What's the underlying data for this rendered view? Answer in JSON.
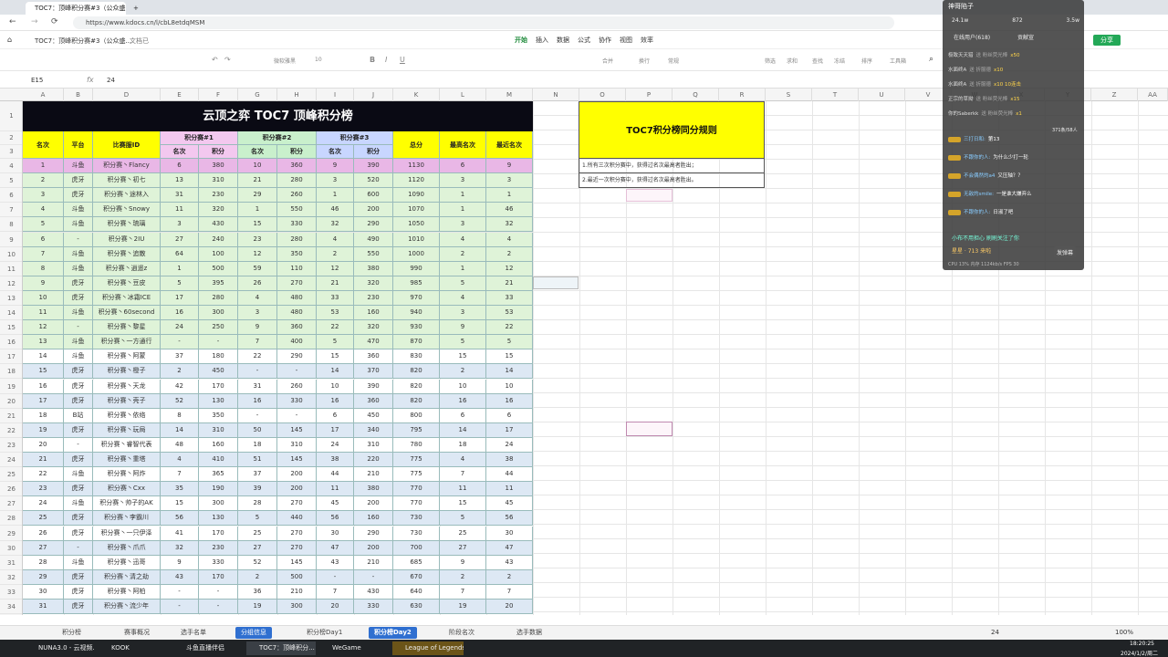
{
  "browser": {
    "tabs": [
      {
        "title": "TOC7：顶峰积分赛#3（公众盛...",
        "active": true
      },
      {
        "title": "+",
        "active": false
      }
    ],
    "url": "https://www.kdocs.cn/l/cbL8etdqMSM"
  },
  "doc": {
    "title": "TOC7：顶峰积分赛#3（公众盛...",
    "saved": "文档已",
    "menu": [
      "开始",
      "插入",
      "数据",
      "公式",
      "协作",
      "视图",
      "效率"
    ],
    "share": "分享",
    "toolbar": [
      "微软雅黑",
      "10",
      "合并",
      "换行",
      "常规",
      "筛选",
      "求和",
      "查找",
      "冻结",
      "排序",
      "工具箱"
    ],
    "cellref": "E15",
    "formula": "24"
  },
  "columns": [
    "A",
    "B",
    "D",
    "E",
    "F",
    "G",
    "H",
    "I",
    "J",
    "K",
    "L",
    "M",
    "N",
    "O",
    "P",
    "Q",
    "R",
    "S",
    "T",
    "U",
    "V",
    "W",
    "X",
    "Y",
    "Z",
    "AA"
  ],
  "table": {
    "title": "云顶之弈 TOC7 顶峰积分榜",
    "headers": {
      "rank": "名次",
      "platform": "平台",
      "id": "比赛服ID",
      "s1": "积分赛#1",
      "s2": "积分赛#2",
      "s3": "积分赛#3",
      "sub_rank": "名次",
      "sub_pts": "积分",
      "total": "总分",
      "best": "最高名次",
      "recent": "最近名次"
    },
    "rows": [
      [
        "1",
        "斗鱼",
        "积分赛丶Flancy",
        "6",
        "380",
        "10",
        "360",
        "9",
        "390",
        "1130",
        "6",
        "9"
      ],
      [
        "2",
        "虎牙",
        "积分赛丶初七",
        "13",
        "310",
        "21",
        "280",
        "3",
        "520",
        "1120",
        "3",
        "3"
      ],
      [
        "3",
        "虎牙",
        "积分赛丶途林入",
        "31",
        "230",
        "29",
        "260",
        "1",
        "600",
        "1090",
        "1",
        "1"
      ],
      [
        "4",
        "斗鱼",
        "积分赛丶Snowy",
        "11",
        "320",
        "1",
        "550",
        "46",
        "200",
        "1070",
        "1",
        "46"
      ],
      [
        "5",
        "斗鱼",
        "积分赛丶琉璃",
        "3",
        "430",
        "15",
        "330",
        "32",
        "290",
        "1050",
        "3",
        "32"
      ],
      [
        "6",
        "-",
        "积分赛丶2IU",
        "27",
        "240",
        "23",
        "280",
        "4",
        "490",
        "1010",
        "4",
        "4"
      ],
      [
        "7",
        "斗鱼",
        "积分赛丶追散",
        "64",
        "100",
        "12",
        "350",
        "2",
        "550",
        "1000",
        "2",
        "2"
      ],
      [
        "8",
        "斗鱼",
        "积分赛丶逍遥z",
        "1",
        "500",
        "59",
        "110",
        "12",
        "380",
        "990",
        "1",
        "12"
      ],
      [
        "9",
        "虎牙",
        "积分赛丶豆皮",
        "5",
        "395",
        "26",
        "270",
        "21",
        "320",
        "985",
        "5",
        "21"
      ],
      [
        "10",
        "虎牙",
        "积分赛丶冰霜ICE",
        "17",
        "280",
        "4",
        "480",
        "33",
        "230",
        "970",
        "4",
        "33"
      ],
      [
        "11",
        "斗鱼",
        "积分赛丶60second",
        "16",
        "300",
        "3",
        "480",
        "53",
        "160",
        "940",
        "3",
        "53"
      ],
      [
        "12",
        "-",
        "积分赛丶黎星",
        "24",
        "250",
        "9",
        "360",
        "22",
        "320",
        "930",
        "9",
        "22"
      ],
      [
        "13",
        "斗鱼",
        "积分赛丶一方通行",
        "-",
        "-",
        "7",
        "400",
        "5",
        "470",
        "870",
        "5",
        "5"
      ],
      [
        "14",
        "斗鱼",
        "积分赛丶阿蒙",
        "37",
        "180",
        "22",
        "290",
        "15",
        "360",
        "830",
        "15",
        "15"
      ],
      [
        "15",
        "虎牙",
        "积分赛丶橙子",
        "2",
        "450",
        "-",
        "-",
        "14",
        "370",
        "820",
        "2",
        "14"
      ],
      [
        "16",
        "虎牙",
        "积分赛丶天龙",
        "42",
        "170",
        "31",
        "260",
        "10",
        "390",
        "820",
        "10",
        "10"
      ],
      [
        "17",
        "虎牙",
        "积分赛丶壳子",
        "52",
        "130",
        "16",
        "330",
        "16",
        "360",
        "820",
        "16",
        "16"
      ],
      [
        "18",
        "B站",
        "积分赛丶依络",
        "8",
        "350",
        "-",
        "-",
        "6",
        "450",
        "800",
        "6",
        "6"
      ],
      [
        "19",
        "虎牙",
        "积分赛丶玩局",
        "14",
        "310",
        "50",
        "145",
        "17",
        "340",
        "795",
        "14",
        "17"
      ],
      [
        "20",
        "-",
        "积分赛丶睿智代表",
        "48",
        "160",
        "18",
        "310",
        "24",
        "310",
        "780",
        "18",
        "24"
      ],
      [
        "21",
        "虎牙",
        "积分赛丶重塔",
        "4",
        "410",
        "51",
        "145",
        "38",
        "220",
        "775",
        "4",
        "38"
      ],
      [
        "22",
        "斗鱼",
        "积分赛丶阿炸",
        "7",
        "365",
        "37",
        "200",
        "44",
        "210",
        "775",
        "7",
        "44"
      ],
      [
        "23",
        "虎牙",
        "积分赛丶Cxx",
        "35",
        "190",
        "39",
        "200",
        "11",
        "380",
        "770",
        "11",
        "11"
      ],
      [
        "24",
        "斗鱼",
        "积分赛丶帅子的AK",
        "15",
        "300",
        "28",
        "270",
        "45",
        "200",
        "770",
        "15",
        "45"
      ],
      [
        "25",
        "虎牙",
        "积分赛丶李霸川",
        "56",
        "130",
        "5",
        "440",
        "56",
        "160",
        "730",
        "5",
        "56"
      ],
      [
        "26",
        "虎牙",
        "积分赛丶一只伊泽",
        "41",
        "170",
        "25",
        "270",
        "30",
        "290",
        "730",
        "25",
        "30"
      ],
      [
        "27",
        "-",
        "积分赛丶爪爪",
        "32",
        "230",
        "27",
        "270",
        "47",
        "200",
        "700",
        "27",
        "47"
      ],
      [
        "28",
        "斗鱼",
        "积分赛丶迅哥",
        "9",
        "330",
        "52",
        "145",
        "43",
        "210",
        "685",
        "9",
        "43"
      ],
      [
        "29",
        "虎牙",
        "积分赛丶清之劫",
        "43",
        "170",
        "2",
        "500",
        "-",
        "-",
        "670",
        "2",
        "2"
      ],
      [
        "30",
        "虎牙",
        "积分赛丶阿柏",
        "-",
        "-",
        "36",
        "210",
        "7",
        "430",
        "640",
        "7",
        "7"
      ],
      [
        "31",
        "虎牙",
        "积分赛丶流少年",
        "-",
        "-",
        "19",
        "300",
        "20",
        "330",
        "630",
        "19",
        "20"
      ]
    ]
  },
  "rules": {
    "title": "TOC7积分榜同分规则",
    "items": [
      "1.所有三次积分赛中，获得过名次最高者胜出；",
      "2.最近一次积分赛中，获得过名次最高者胜出。"
    ]
  },
  "stream": {
    "name": "神哥陷子",
    "stats": [
      "24.1w",
      "872",
      "3.5w"
    ],
    "tabs": [
      "在线用户(618)",
      "贡献宣"
    ],
    "gifts": [
      {
        "user": "极致天天猎",
        "text": "送 粉丝荧光棒",
        "count": "x50"
      },
      {
        "user": "水面终A",
        "text": "送 折服德",
        "count": "x10"
      },
      {
        "user": "水面终A",
        "text": "送 折服德",
        "count": "x10 10连击"
      },
      {
        "user": "正宗的草拗",
        "text": "送 粉丝荧光棒",
        "count": "x15"
      },
      {
        "user": "你的Saberkk",
        "text": "送 粉丝荧光棒",
        "count": "x1"
      }
    ],
    "chat": [
      {
        "user": "三打日和:",
        "text": "第13"
      },
      {
        "user": "不跟你的人:",
        "text": "为什么少打一轮"
      },
      {
        "user": "不会偶然的a4",
        "text": "又压轴？？"
      },
      {
        "user": "无敌的smile:",
        "text": "一是谁大嫌弃么"
      },
      {
        "user": "不跟你的人:",
        "text": "日淑了吧"
      }
    ],
    "notice": "小布不用担心 刷刷关注了你",
    "viewer": "星星 · 713 来啦",
    "footer": "CPU 13%  内存 1124kb/s  FPS 30",
    "count": "371条/58人",
    "send": "发弹幕"
  },
  "sheets": [
    "积分榜",
    "赛事概况",
    "选手名单",
    "分组信息",
    "积分榜Day1",
    "积分榜Day2",
    "阶段名次",
    "选手数据"
  ],
  "active_sheet": "积分榜Day2",
  "status": {
    "value": "24",
    "zoom": "100%"
  },
  "taskbar": {
    "apps": [
      "NUNA3.0 - 云视频...",
      "KOOK",
      "斗鱼直播伴侣",
      "TOC7：顶峰积分...",
      "WeGame",
      "League of Legends"
    ],
    "time": "18:20:25",
    "date": "2024/1/2/周二"
  }
}
